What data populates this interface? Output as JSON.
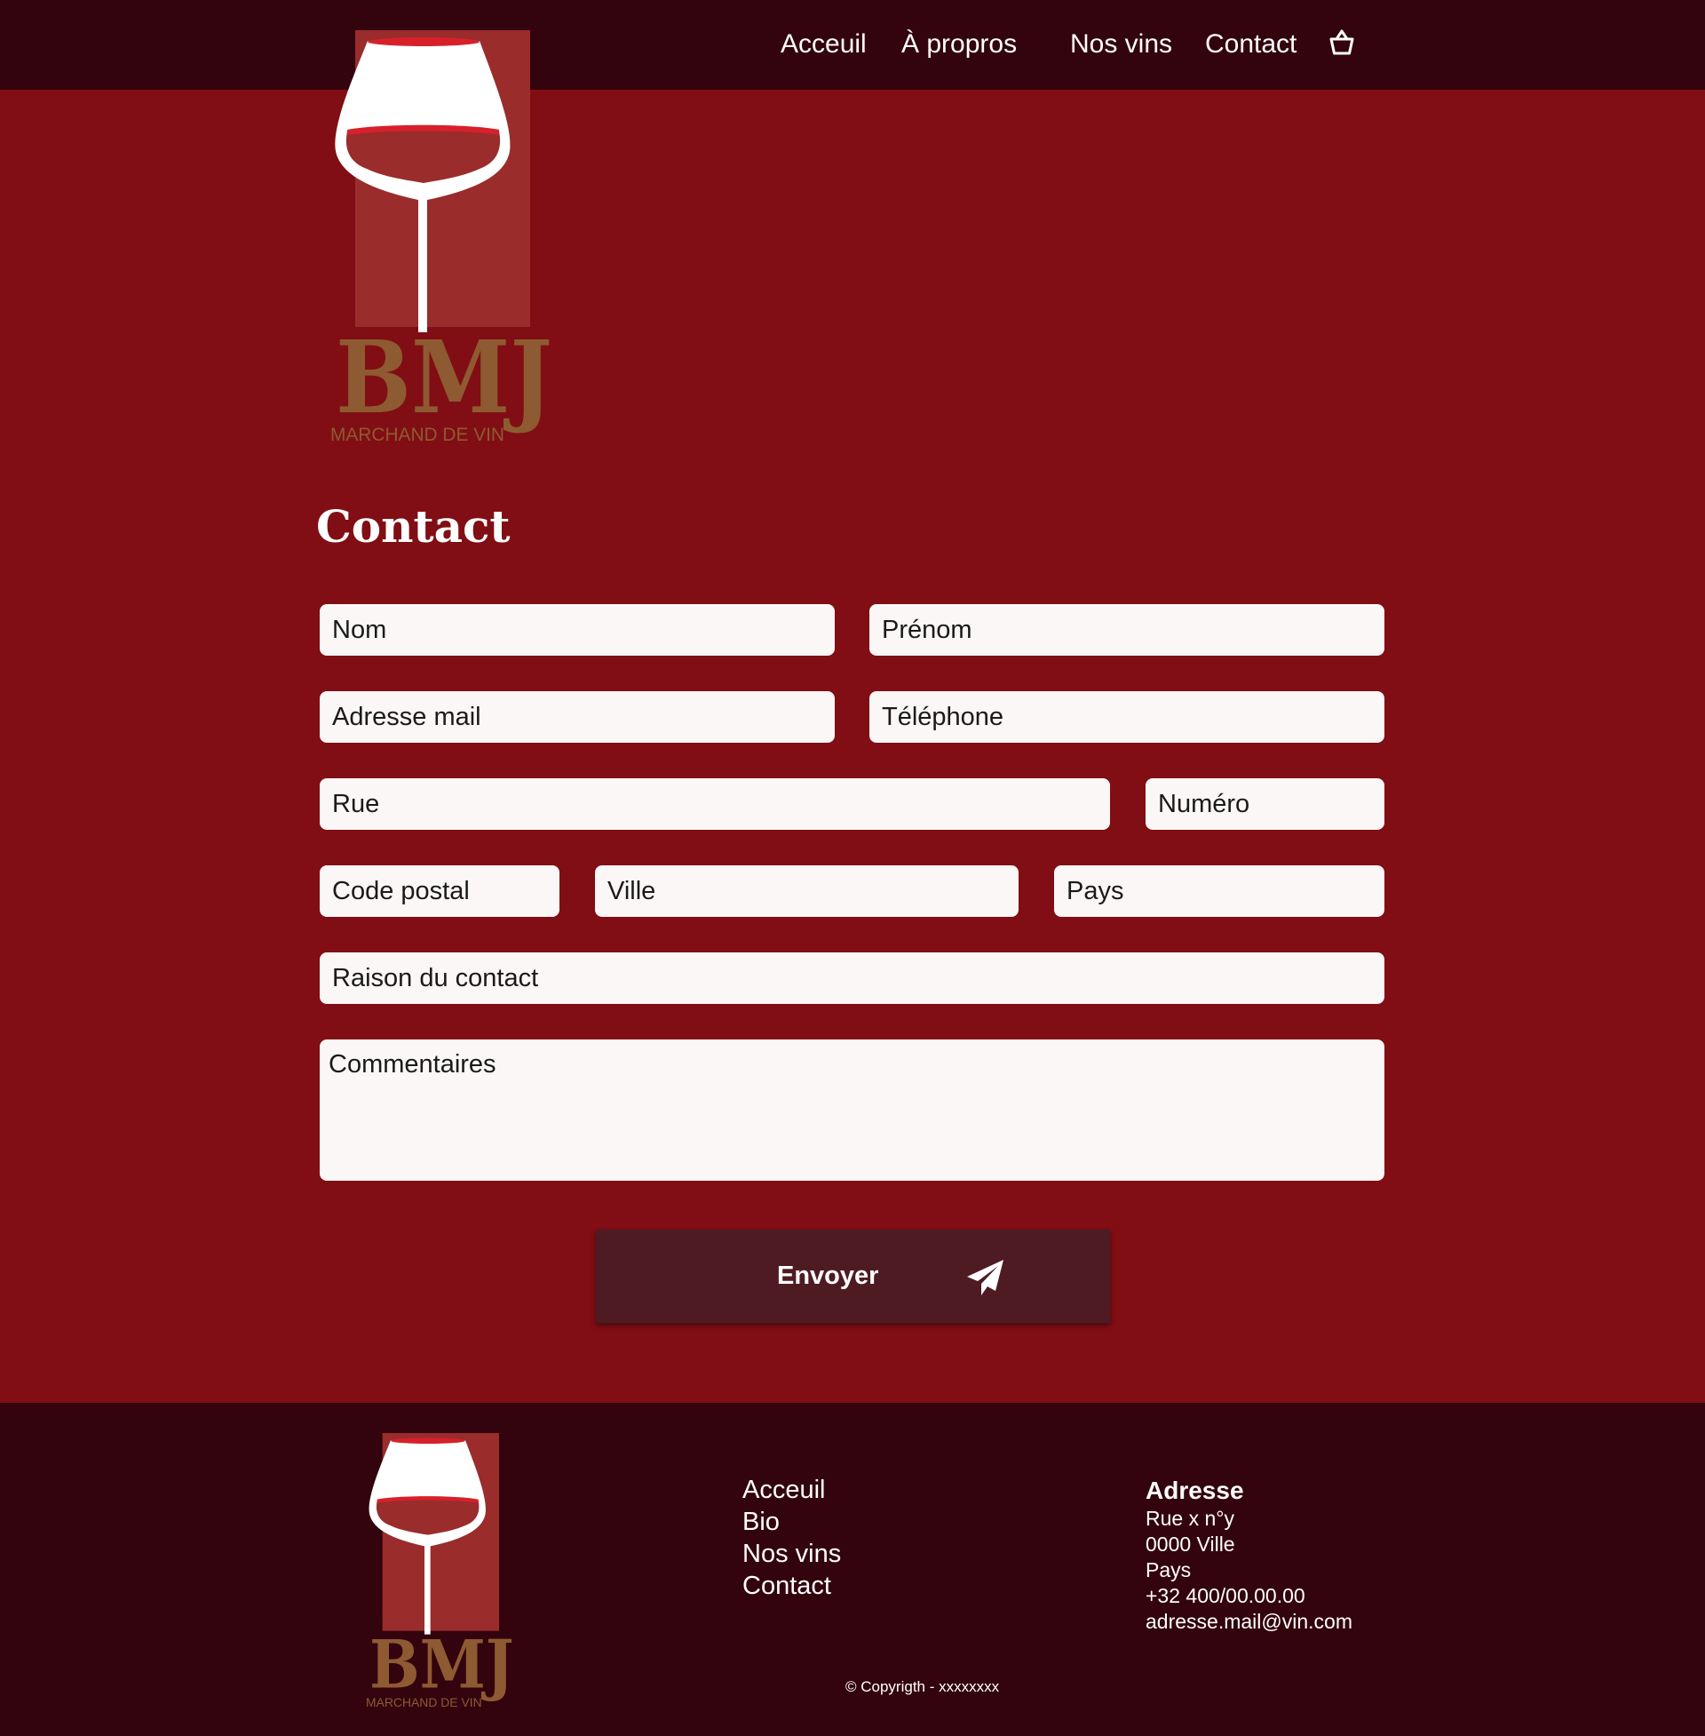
{
  "brand": {
    "logo_letters": "BMJ",
    "logo_tagline": "MARCHAND DE VIN"
  },
  "nav": {
    "items": [
      "Acceuil",
      "À propros",
      "Nos vins",
      "Contact"
    ],
    "cart_icon": "shopping-basket-icon"
  },
  "page": {
    "title": "Contact"
  },
  "form": {
    "nom": "Nom",
    "prenom": "Prénom",
    "email": "Adresse mail",
    "telephone": "Téléphone",
    "rue": "Rue",
    "numero": "Numéro",
    "code_postal": "Code postal",
    "ville": "Ville",
    "pays": "Pays",
    "raison": "Raison du contact",
    "commentaires": "Commentaires",
    "submit_label": "Envoyer",
    "submit_icon": "paper-plane-icon"
  },
  "footer": {
    "links": [
      "Acceuil",
      "Bio",
      "Nos vins",
      "Contact"
    ],
    "address_title": "Adresse",
    "address_lines": [
      "Rue x n°y",
      "0000 Ville",
      "Pays",
      "+32 400/00.00.00",
      "adresse.mail@vin.com"
    ],
    "copyright": "© Copyrigth - xxxxxxxx"
  },
  "colors": {
    "background": "#810e14",
    "header_footer": "#33040e",
    "button": "#4e1b23",
    "field": "#fbf7f6",
    "logo_panel": "#9a2c2c",
    "logo_gold": "#8e5a31",
    "wine_red": "#d8202a"
  }
}
